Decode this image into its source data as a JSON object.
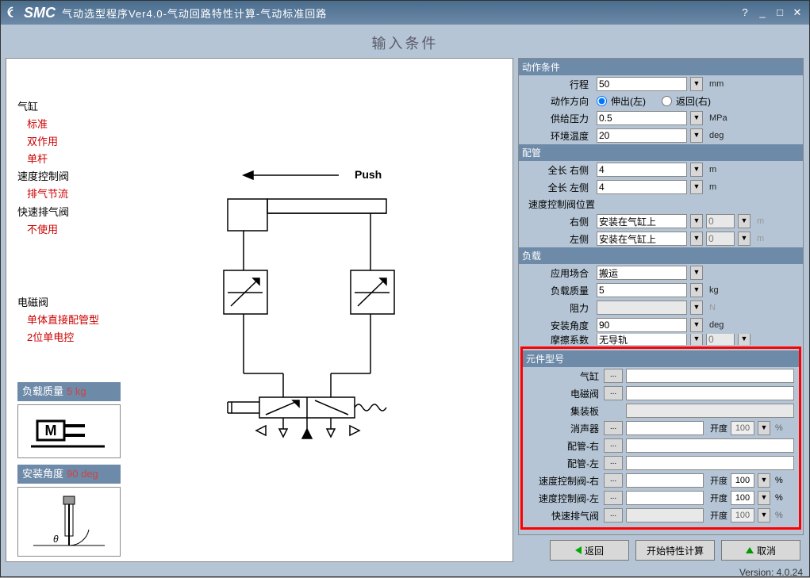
{
  "title_text": "气动选型程序Ver4.0-气动回路特性计算-气动标准回路",
  "logo": "SMC",
  "header": "输入条件",
  "sidebar": {
    "cylinder": "气缸",
    "cyl_items": [
      "标准",
      "双作用",
      "单杆"
    ],
    "speed_valve": "速度控制阀",
    "sv_items": [
      "排气节流"
    ],
    "quick_exhaust": "快速排气阀",
    "qe_items": [
      "不使用"
    ],
    "solenoid": "电磁阀",
    "so_items": [
      "单体直接配管型",
      "2位单电控"
    ],
    "load_mass_label": "负载质量",
    "load_mass_val": "5 kg",
    "install_angle_label": "安装角度",
    "install_angle_val": "90 deg"
  },
  "push_label": "Push",
  "right": {
    "sect_op": "动作条件",
    "stroke_lbl": "行程",
    "stroke": "50",
    "stroke_unit": "mm",
    "dir_lbl": "动作方向",
    "dir_ext": "伸出(左)",
    "dir_ret": "返回(右)",
    "supply_lbl": "供给压力",
    "supply": "0.5",
    "supply_unit": "MPa",
    "temp_lbl": "环境温度",
    "temp": "20",
    "temp_unit": "deg",
    "sect_pipe": "配管",
    "len_r_lbl": "全长 右侧",
    "len_r": "4",
    "len_r_unit": "m",
    "len_l_lbl": "全长 左侧",
    "len_l": "4",
    "len_l_unit": "m",
    "sv_pos_lbl": "速度控制阀位置",
    "pos_r_lbl": "右侧",
    "pos_r": "安装在气缸上",
    "pos_r_n": "0",
    "pos_l_lbl": "左侧",
    "pos_l": "安装在气缸上",
    "pos_l_n": "0",
    "sect_load": "负载",
    "app_lbl": "应用场合",
    "app": "搬运",
    "mass_lbl": "负载质量",
    "mass": "5",
    "mass_unit": "kg",
    "resist_lbl": "阻力",
    "resist": "",
    "resist_unit": "N",
    "angle_lbl": "安装角度",
    "angle": "90",
    "angle_unit": "deg",
    "fric_lbl": "摩擦系数",
    "fric": "无导轨",
    "fric_n": "0",
    "sect_part": "元件型号",
    "parts": {
      "cyl": "气缸",
      "sol": "电磁阀",
      "manifold": "集装板",
      "silencer": "消声器",
      "pipe_r": "配管-右",
      "pipe_l": "配管-左",
      "sv_r": "速度控制阀-右",
      "sv_l": "速度控制阀-左",
      "qe": "快速排气阀"
    },
    "opening": "开度",
    "open_val": "100",
    "pct": "%"
  },
  "btns": {
    "back": "返回",
    "calc": "开始特性计算",
    "cancel": "取消"
  },
  "version": "Version: 4.0.24"
}
